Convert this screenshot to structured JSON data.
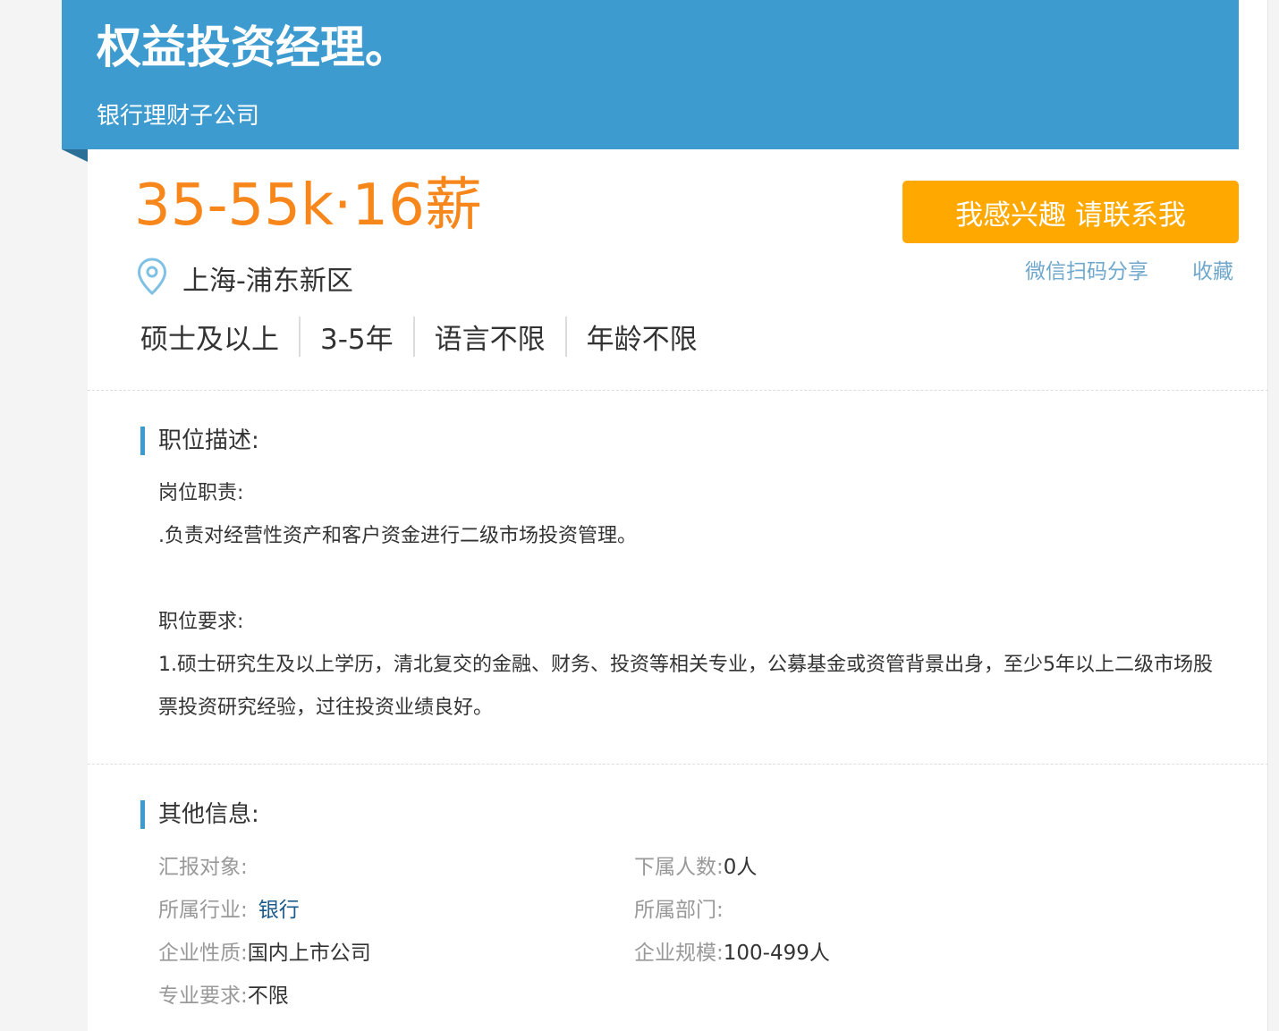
{
  "header": {
    "title": "权益投资经理。",
    "company": "银行理财子公司"
  },
  "summary": {
    "salary": "35-55k·16薪",
    "location": "上海-浦东新区",
    "tags": [
      "硕士及以上",
      "3-5年",
      "语言不限",
      "年龄不限"
    ]
  },
  "actions": {
    "contact_label": "我感兴趣 请联系我",
    "share_label": "微信扫码分享",
    "favorite_label": "收藏"
  },
  "description": {
    "heading": "职位描述:",
    "lines": [
      "岗位职责:",
      ".负责对经营性资产和客户资金进行二级市场投资管理。",
      "",
      "职位要求:",
      "1.硕士研究生及以上学历，清北复交的金融、财务、投资等相关专业，公募基金或资管背景出身，至少5年以上二级市场股票投资研究经验，过往投资业绩良好。"
    ]
  },
  "other_info": {
    "heading": "其他信息:",
    "report_to_label": "汇报对象:",
    "report_to_value": "",
    "subordinates_label": "下属人数:",
    "subordinates_value": "0人",
    "industry_label": "所属行业:",
    "industry_value": "银行",
    "department_label": "所属部门:",
    "department_value": "",
    "nature_label": "企业性质:",
    "nature_value": "国内上市公司",
    "scale_label": "企业规模:",
    "scale_value": "100-499人",
    "major_label": "专业要求:",
    "major_value": "不限"
  },
  "colors": {
    "header_blue": "#3d9bcf",
    "salary_orange": "#f7861b",
    "button_orange": "#ffa900",
    "link_blue": "#6fa8cc"
  },
  "icons": {
    "location": "map-pin-icon"
  }
}
